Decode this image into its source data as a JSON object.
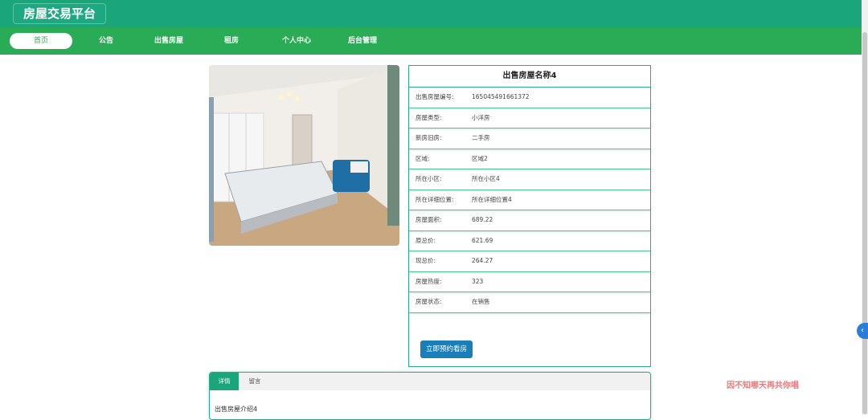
{
  "header": {
    "brand": "房屋交易平台"
  },
  "nav": {
    "items": [
      "首页",
      "公告",
      "出售房屋",
      "租房",
      "个人中心",
      "后台管理"
    ],
    "active_index": 0
  },
  "listing": {
    "title": "出售房屋名称4",
    "rows": [
      {
        "label": "出售房屋编号:",
        "value": "1650454916613​72"
      },
      {
        "label": "房屋类型:",
        "value": "小洋房"
      },
      {
        "label": "新房旧房:",
        "value": "二手房"
      },
      {
        "label": "区域:",
        "value": "区域2"
      },
      {
        "label": "所在小区:",
        "value": "所在小区4"
      },
      {
        "label": "所在详细位置:",
        "value": "所在详细位置4"
      },
      {
        "label": "房屋面积:",
        "value": "689.22"
      },
      {
        "label": "原总价:",
        "value": "621.69"
      },
      {
        "label": "现总价:",
        "value": "264.27"
      },
      {
        "label": "房屋热度:",
        "value": "323"
      },
      {
        "label": "房屋状态:",
        "value": "在销售"
      }
    ],
    "book_button": "立即预约看房"
  },
  "tabs": {
    "items": [
      "详情",
      "留言"
    ],
    "content": "出售房屋介绍4"
  },
  "watermark": "因不知哪天再共你唱",
  "side_tab_icon": "chevron-left-icon",
  "colors": {
    "topbar": "#1aa57a",
    "navbar": "#2aab55",
    "accent_border": "#2aab8a",
    "button": "#1a7fb8"
  }
}
